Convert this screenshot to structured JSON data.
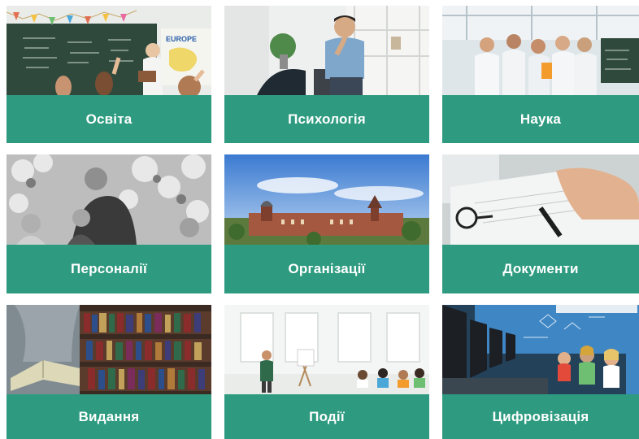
{
  "colors": {
    "tile_label_bg": "#2e9b80",
    "label_text": "#ffffff"
  },
  "categories": [
    {
      "label": "Освіта",
      "image": "classroom-photo"
    },
    {
      "label": "Психологія",
      "image": "thinking-man-photo"
    },
    {
      "label": "Наука",
      "image": "scientists-lab-photo"
    },
    {
      "label": "Персоналії",
      "image": "historical-portrait-photo"
    },
    {
      "label": "Організації",
      "image": "university-campus-photo"
    },
    {
      "label": "Документи",
      "image": "signing-document-photo"
    },
    {
      "label": "Видання",
      "image": "bookshelf-photo"
    },
    {
      "label": "Події",
      "image": "seminar-event-photo"
    },
    {
      "label": "Цифровізація",
      "image": "computer-class-photo"
    }
  ],
  "tile_images": {
    "classroom_sign": "EUROPE"
  }
}
